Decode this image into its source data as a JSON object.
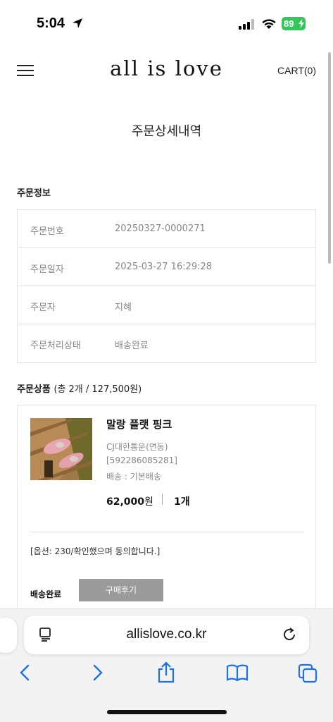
{
  "status_bar": {
    "time": "5:04",
    "battery": "89"
  },
  "header": {
    "logo": "all is love",
    "cart": "CART(0)"
  },
  "page_title": "주문상세내역",
  "order_info": {
    "title": "주문정보",
    "rows": [
      {
        "label": "주문번호",
        "value": "20250327-0000271"
      },
      {
        "label": "주문일자",
        "value": "2025-03-27 16:29:28"
      },
      {
        "label": "주문자",
        "value": "지혜"
      },
      {
        "label": "주문처리상태",
        "value": "배송완료"
      }
    ]
  },
  "order_items": {
    "title": "주문상품",
    "summary": "(총 2개 / 127,500원)",
    "item": {
      "name": "말랑 플랫 핑크",
      "courier": "CJ대한통운(연동)",
      "tracking": "[592286085281]",
      "shipping": "배송 : 기본배송",
      "price": "62,000",
      "price_unit": "원",
      "quantity": "1개",
      "option": "[옵션: 230/확인했으며 동의합니다.]",
      "status": "배송완료",
      "review_button": "구매후기"
    }
  },
  "browser": {
    "url": "allislove.co.kr"
  },
  "colors": {
    "battery": "#33c759",
    "review_button": "#9b9b9b",
    "ios_blue": "#1a73e8"
  }
}
